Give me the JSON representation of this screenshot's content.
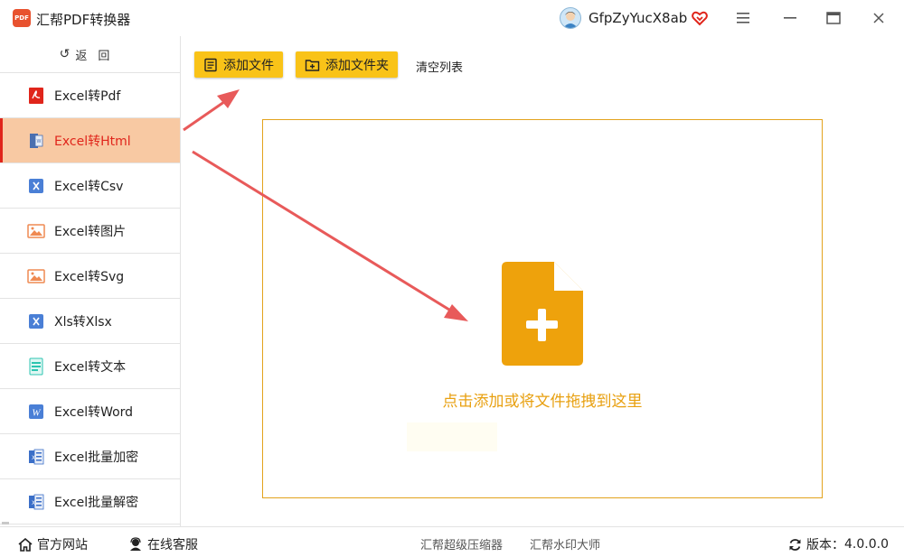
{
  "app": {
    "logo_text": "PDF",
    "title": "汇帮PDF转换器",
    "username": "GfpZyYucX8ab"
  },
  "sidebar": {
    "back_label": "返回",
    "items": [
      {
        "label": "Excel转Pdf",
        "icon": "pdf-icon"
      },
      {
        "label": "Excel转Html",
        "icon": "html-icon",
        "active": true
      },
      {
        "label": "Excel转Csv",
        "icon": "excel-x-icon"
      },
      {
        "label": "Excel转图片",
        "icon": "image-icon"
      },
      {
        "label": "Excel转Svg",
        "icon": "image-icon"
      },
      {
        "label": "Xls转Xlsx",
        "icon": "excel-x-icon"
      },
      {
        "label": "Excel转文本",
        "icon": "text-doc-icon"
      },
      {
        "label": "Excel转Word",
        "icon": "word-icon"
      },
      {
        "label": "Excel批量加密",
        "icon": "excel-lock-icon"
      },
      {
        "label": "Excel批量解密",
        "icon": "excel-unlock-icon"
      }
    ]
  },
  "toolbar": {
    "add_file": "添加文件",
    "add_folder": "添加文件夹",
    "clear_list": "清空列表"
  },
  "dropzone": {
    "hint": "点击添加或将文件拖拽到这里"
  },
  "footer": {
    "website": "官方网站",
    "support": "在线客服",
    "link1": "汇帮超级压缩器",
    "link2": "汇帮水印大师",
    "version_label": "版本：",
    "version": "4.0.0.0"
  },
  "colors": {
    "accent_yellow": "#f9c318",
    "active_bg": "#f8c9a3",
    "active_text": "#e0251b",
    "dropzone_border": "#e3a31d",
    "arrow": "#e85a5a"
  }
}
